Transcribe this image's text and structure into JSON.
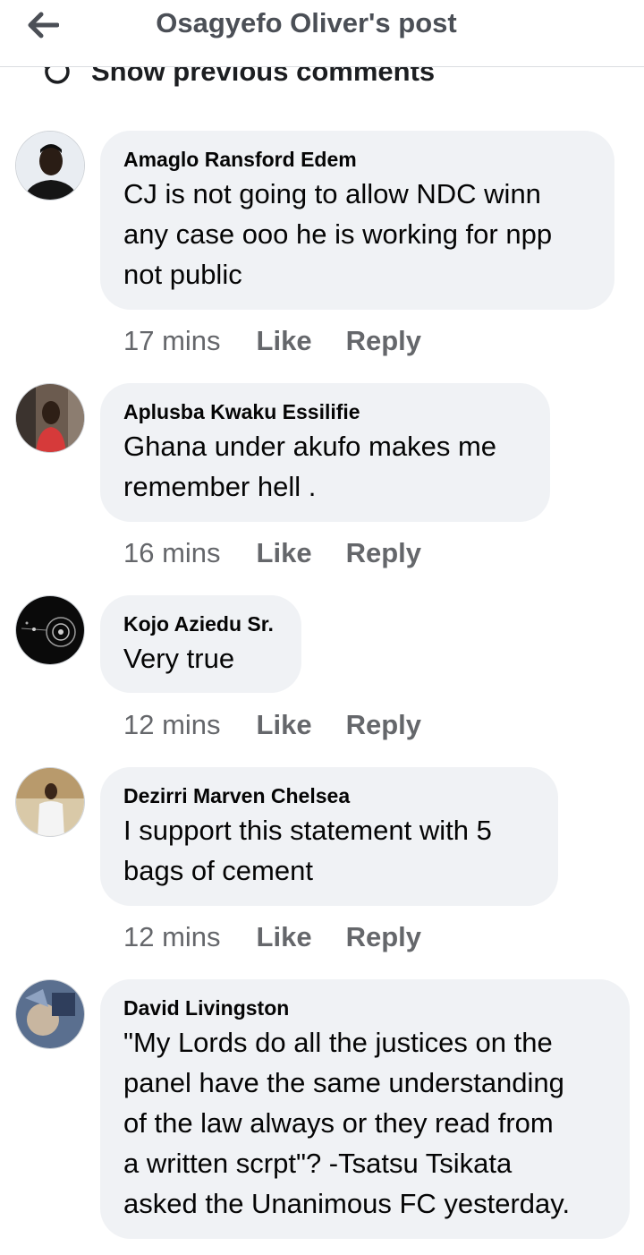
{
  "header": {
    "title": "Osagyefo Oliver's post",
    "back_icon": "arrow-left-icon"
  },
  "show_previous": {
    "label": "Show previous comments",
    "icon": "refresh-icon"
  },
  "actions": {
    "like": "Like",
    "reply": "Reply"
  },
  "colors": {
    "bubble": "#f0f2f5",
    "secondary_text": "#65676b",
    "divider": "#dadde1"
  },
  "comments": [
    {
      "name": "Amaglo Ransford Edem",
      "text": "CJ is not going to allow NDC winn\nany case ooo he is working for npp\nnot public",
      "time": "17 mins"
    },
    {
      "name": "Aplusba Kwaku Essilifie",
      "text": "Ghana under akufo makes me\nremember hell .",
      "time": "16 mins"
    },
    {
      "name": "Kojo Aziedu Sr.",
      "text": "Very true",
      "time": "12 mins"
    },
    {
      "name": "Dezirri Marven Chelsea",
      "text": "I support this statement with 5\nbags of cement",
      "time": "12 mins"
    },
    {
      "name": "David Livingston",
      "text": "\"My Lords do all the justices on the\npanel have the same understanding\nof the law always or they read from\na written scrpt\"? -Tsatsu Tsikata\nasked the Unanimous FC yesterday.",
      "time": ""
    }
  ]
}
